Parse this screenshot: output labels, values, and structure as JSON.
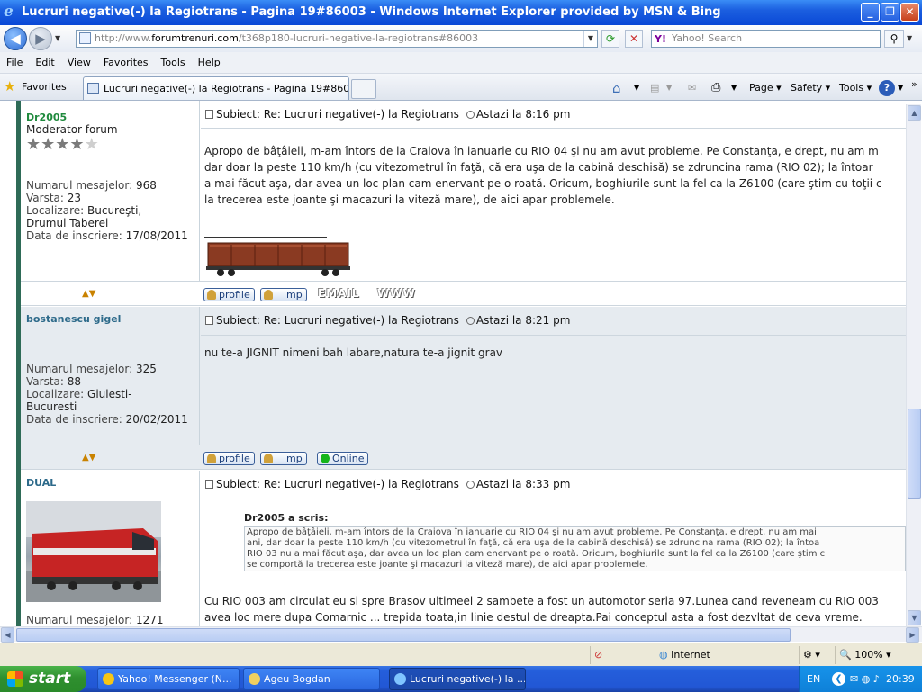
{
  "window": {
    "title": "Lucruri negative(-) la Regiotrans - Pagina 19#86003 - Windows Internet Explorer provided by MSN & Bing"
  },
  "address": {
    "url_prefix": "http://www.",
    "url_domain": "forumtrenuri.com",
    "url_path": "/t368p180-lucruri-negative-la-regiotrans#86003",
    "search_placeholder": "Yahoo! Search"
  },
  "menu": [
    "File",
    "Edit",
    "View",
    "Favorites",
    "Tools",
    "Help"
  ],
  "favorites": {
    "label": "Favorites",
    "tab_title": "Lucruri negative(-) la Regiotrans - Pagina 19#86003"
  },
  "commands": {
    "page": "Page",
    "safety": "Safety",
    "tools": "Tools"
  },
  "posts": [
    {
      "username": "Dr2005",
      "rank": "Moderator forum",
      "rating_stars": 4,
      "rating_max": 5,
      "labels": {
        "messages": "Numarul mesajelor:",
        "age": "Varsta:",
        "location": "Localizare:",
        "joined": "Data de inscriere:"
      },
      "messages": "968",
      "age": "23",
      "location_line1": "Bucureşti,",
      "location_line2": "Drumul Taberei",
      "joined": "17/08/2011",
      "subject": "Subiect: Re: Lucruri negative(-) la Regiotrans",
      "time": "Astazi la 8:16 pm",
      "body": [
        "Apropo de bâţâieli, m-am întors de la Craiova în ianuarie cu RIO 04 şi nu am avut probleme. Pe Constanţa, e drept, nu am m",
        "dar doar la peste 110 km/h (cu vitezometrul în faţă, că era uşa de la cabină deschisă) se zdruncina rama (RIO 02); la întoar",
        "a mai făcut aşa, dar avea un loc plan cam enervant pe o roată. Oricum, boghiurile sunt la fel ca la Z6100 (care ştim cu toţii c",
        "la trecerea este joante şi macazuri la viteză mare), de aici apar problemele."
      ],
      "buttons": {
        "profile": "profile",
        "pm": "mp",
        "email": "EMAIL",
        "www": "WWW"
      }
    },
    {
      "username": "bostanescu gigel",
      "messages": "325",
      "age": "88",
      "location_line1": "Giulesti-",
      "location_line2": "Bucuresti",
      "joined": "20/02/2011",
      "subject": "Subiect: Re: Lucruri negative(-) la Regiotrans",
      "time": "Astazi la 8:21 pm",
      "body": [
        "nu te-a JIGNIT nimeni bah labare,natura te-a jignit grav"
      ],
      "buttons": {
        "profile": "profile",
        "pm": "mp",
        "online": "Online"
      }
    },
    {
      "username": "DUAL",
      "messages": "1271",
      "subject": "Subiect: Re: Lucruri negative(-) la Regiotrans",
      "time": "Astazi la 8:33 pm",
      "quote_author": "Dr2005 a scris:",
      "quote": [
        "Apropo de bâţâieli, m-am întors de la Craiova în ianuarie cu RIO 04 şi nu am avut probleme. Pe Constanţa, e drept, nu am mai",
        "ani, dar doar la peste 110 km/h (cu vitezometrul în faţă, că era uşa de la cabină deschisă) se zdruncina rama (RIO 02); la întoa",
        "RIO 03 nu a mai făcut aşa, dar avea un loc plan cam enervant pe o roată. Oricum, boghiurile sunt la fel ca la Z6100 (care ştim c",
        "se comportă la trecerea este joante şi macazuri la viteză mare), de aici apar problemele."
      ],
      "body": [
        "Cu RIO 003 am circulat eu si spre Brasov ultimeel 2 sambete a fost un automotor seria 97.Lunea cand reveneam cu RIO 003",
        "avea loc mere dupa Comarnic ... trepida toata,in linie destul de dreapta.Pai conceptul asta a fost dezvltat de ceva vreme."
      ]
    }
  ],
  "status": {
    "zone": "Internet",
    "zoom": "100%"
  },
  "taskbar": {
    "start": "start",
    "tasks": [
      "Yahoo! Messenger (N...",
      "Ageu Bogdan",
      "Lucruri negative(-) la ..."
    ],
    "lang": "EN",
    "clock": "20:39"
  },
  "colors": {
    "titlebar": "#0a48d6",
    "username_green": "#1f8a3d",
    "username_blue": "#2d6a8a",
    "taskbar": "#245edb",
    "start": "#2f8f2f"
  }
}
